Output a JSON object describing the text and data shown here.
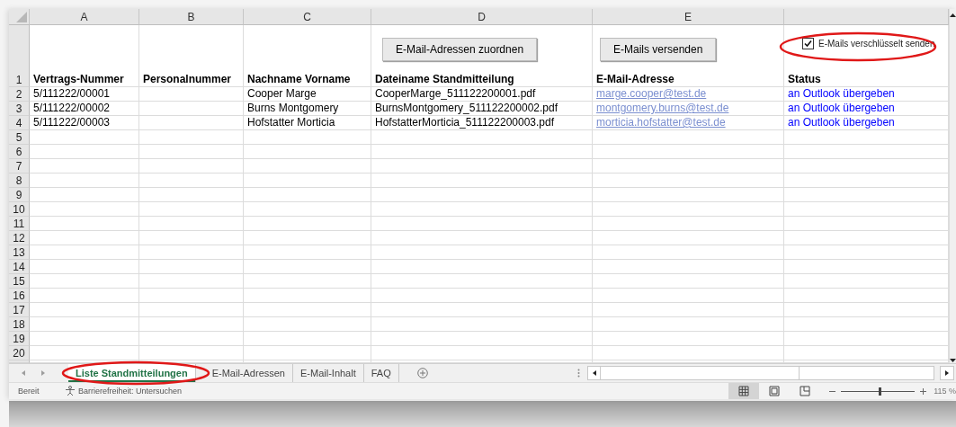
{
  "column_headers": [
    "A",
    "B",
    "C",
    "D",
    "E"
  ],
  "controls": {
    "assign_button": "E-Mail-Adressen zuordnen",
    "send_button": "E-Mails versenden",
    "encrypt_checkbox": {
      "label": "E-Mails verschlüsselt senden",
      "checked": true
    }
  },
  "header_row": {
    "number": "1",
    "headings": [
      "Vertrags-Nummer",
      "Personalnummer",
      "Nachname Vorname",
      "Dateiname Standmitteilung",
      "E-Mail-Adresse",
      "Status"
    ]
  },
  "rows": [
    {
      "number": "2",
      "contract": "5/111222/00001",
      "name": "Cooper Marge",
      "file": "CooperMarge_511122200001.pdf",
      "email": "marge.cooper@test.de",
      "status": "an Outlook übergeben"
    },
    {
      "number": "3",
      "contract": "5/111222/00002",
      "name": "Burns Montgomery",
      "file": "BurnsMontgomery_511122200002.pdf",
      "email": "montgomery.burns@test.de",
      "status": "an Outlook übergeben"
    },
    {
      "number": "4",
      "contract": "5/111222/00003",
      "name": "Hofstatter Morticia",
      "file": "HofstatterMorticia_511122200003.pdf",
      "email": "morticia.hofstatter@test.de",
      "status": "an Outlook übergeben"
    }
  ],
  "empty_rows": [
    "5",
    "6",
    "7",
    "8",
    "9",
    "10",
    "11",
    "12",
    "13",
    "14",
    "15",
    "16",
    "17",
    "18",
    "19",
    "20"
  ],
  "sheet_tabs": [
    {
      "label": "Liste Standmitteilungen",
      "selected": true
    },
    {
      "label": "E-Mail-Adressen",
      "selected": false
    },
    {
      "label": "E-Mail-Inhalt",
      "selected": false
    },
    {
      "label": "FAQ",
      "selected": false
    }
  ],
  "status_bar": {
    "ready": "Bereit",
    "accessibility": "Barrierefreiheit: Untersuchen",
    "views": [
      {
        "selected": true
      },
      {
        "selected": false
      },
      {
        "selected": false
      }
    ],
    "zoom": {
      "level": 0.52,
      "reading": "115 %"
    }
  }
}
